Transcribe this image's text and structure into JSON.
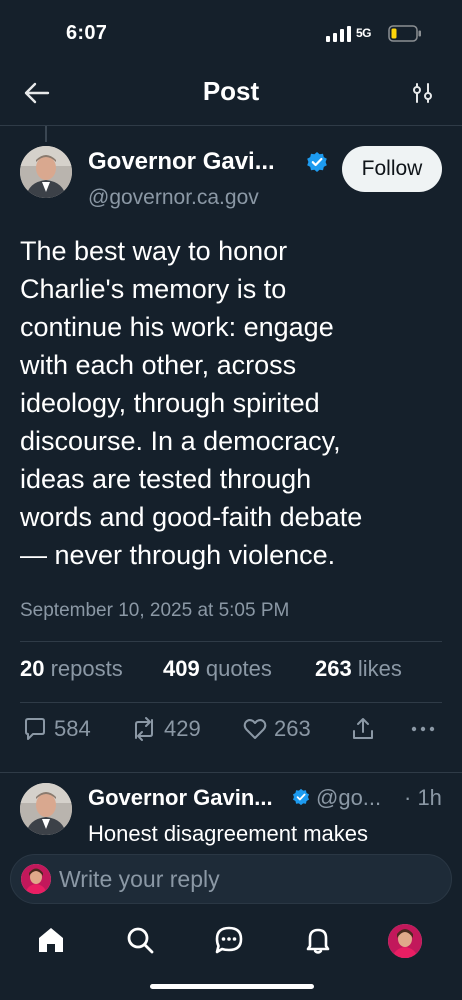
{
  "status_bar": {
    "time": "6:07",
    "network": "5G",
    "battery_level": 0.2
  },
  "nav": {
    "title": "Post",
    "back_icon": "arrow-left-icon",
    "filter_icon": "sliders-icon"
  },
  "post": {
    "author_name": "Governor Gavi...",
    "author_handle": "@governor.ca.gov",
    "verified": true,
    "follow_label": "Follow",
    "body_lines": [
      "The best way to honor",
      "Charlie's memory is to",
      "continue his work: engage",
      "with each other, across",
      "ideology, through spirited",
      "discourse. In a democracy,",
      "ideas are tested through",
      "words and good-faith debate",
      "— never through violence."
    ],
    "timestamp": "September 10, 2025 at 5:05 PM",
    "stats": {
      "reposts_count": "20",
      "reposts_label": "reposts",
      "quotes_count": "409",
      "quotes_label": "quotes",
      "likes_count": "263",
      "likes_label": "likes"
    },
    "actions": {
      "replies": "584",
      "reposts": "429",
      "likes": "263"
    }
  },
  "reply": {
    "author_name": "Governor Gavin...",
    "handle": "@go...",
    "time": "· 1h",
    "text": "Honest disagreement makes"
  },
  "composer": {
    "placeholder": "Write your reply"
  },
  "tab_bar": {
    "items": [
      "home-icon",
      "search-icon",
      "messages-icon",
      "notifications-icon",
      "profile-avatar"
    ]
  },
  "colors": {
    "background": "#15202b",
    "accent": "#1d9bf0",
    "muted": "#8b98a5",
    "divider": "#2f3b47"
  }
}
